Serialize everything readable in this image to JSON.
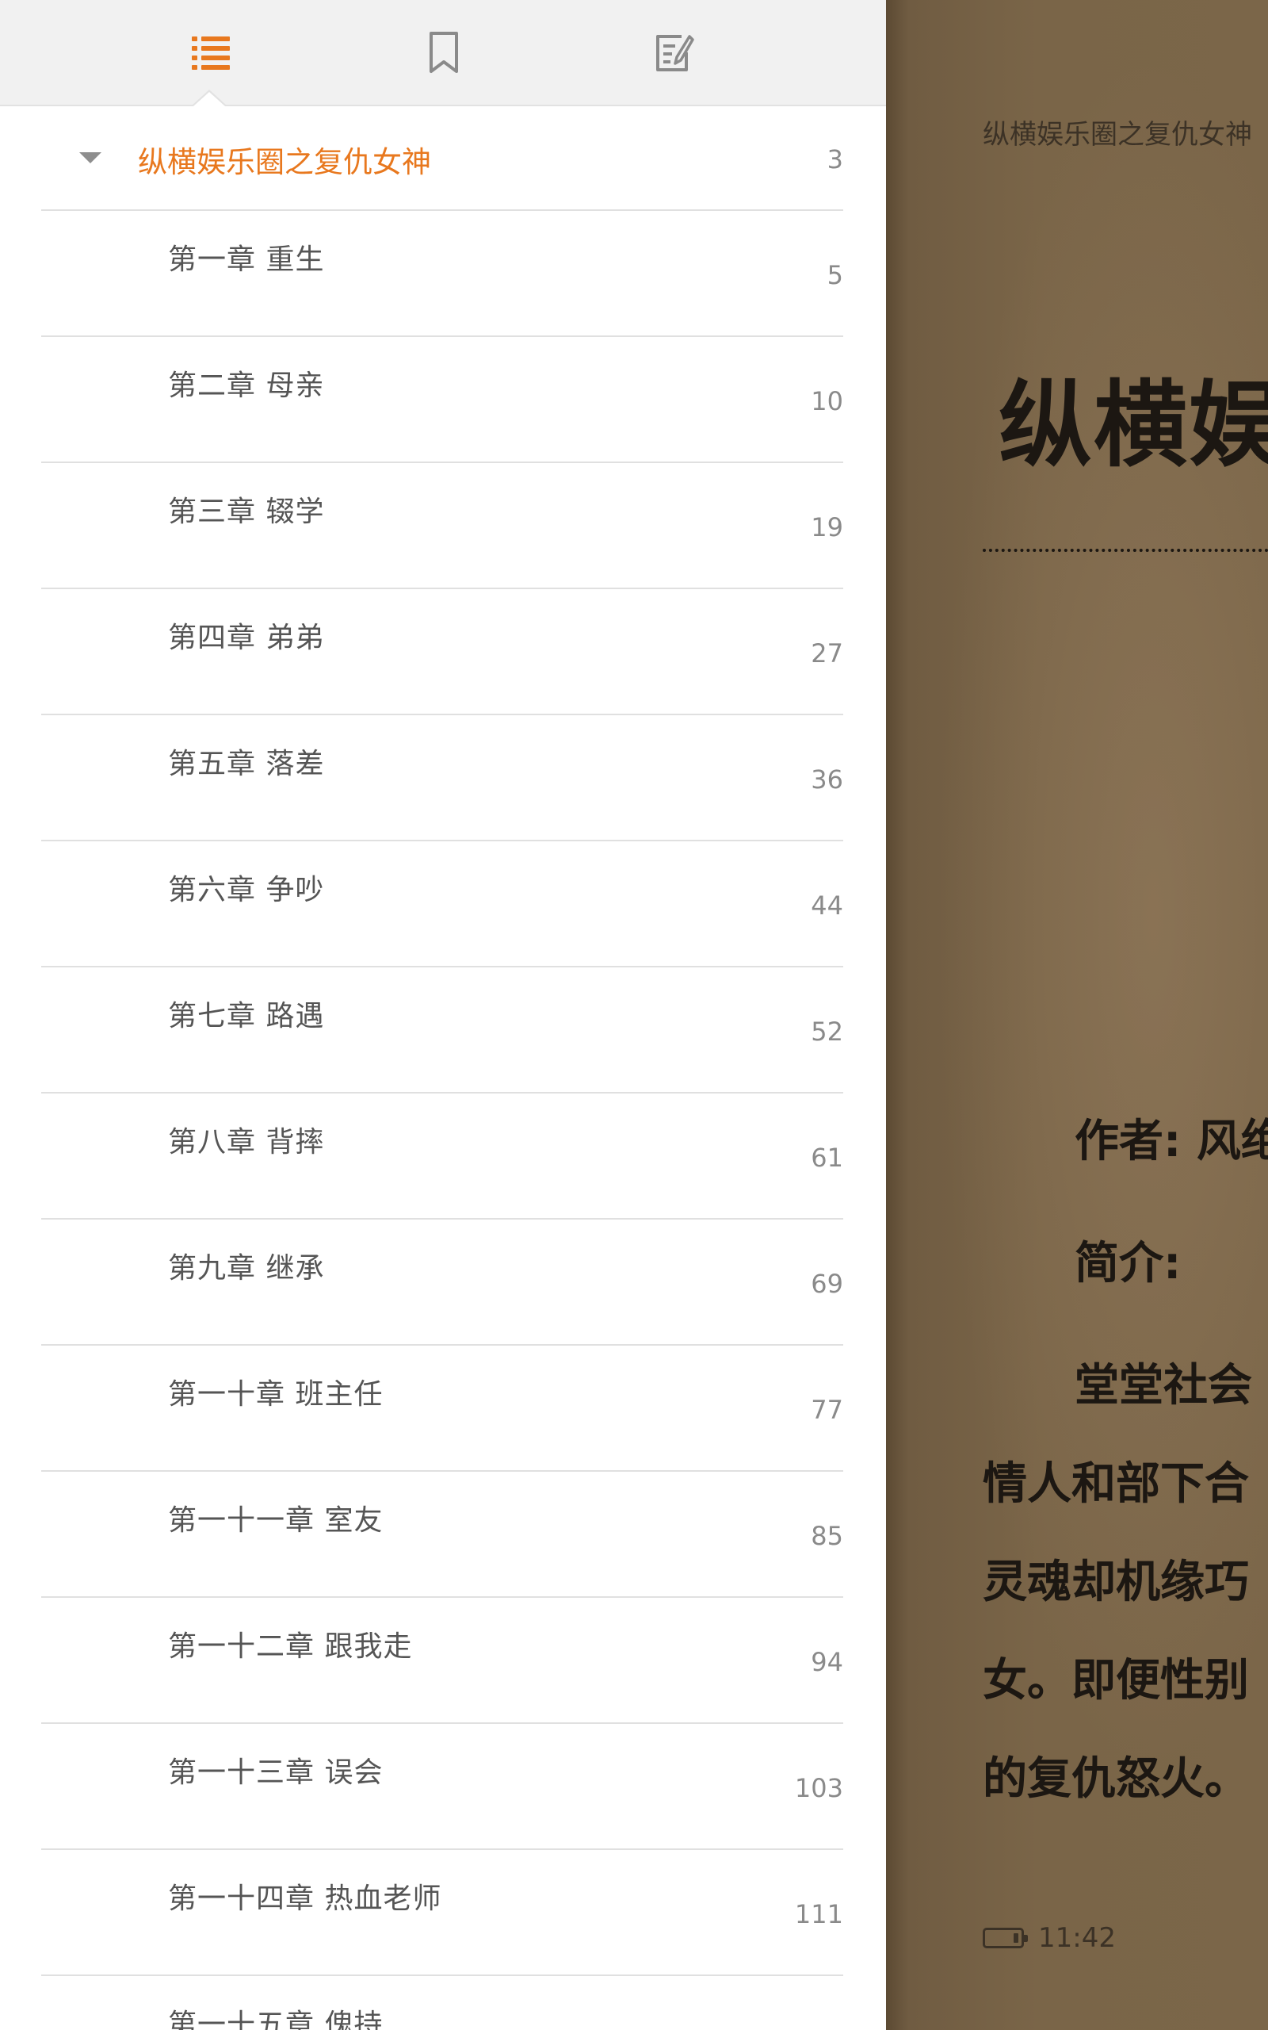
{
  "toc": {
    "tabs": [
      {
        "name": "contents",
        "icon": "list-icon",
        "active": true
      },
      {
        "name": "bookmarks",
        "icon": "bookmark-icon",
        "active": false
      },
      {
        "name": "notes",
        "icon": "note-edit-icon",
        "active": false
      }
    ],
    "accent_color": "#e8781e",
    "book": {
      "title": "纵横娱乐圈之复仇女神",
      "page": "3"
    },
    "chapters": [
      {
        "title": "第一章 重生",
        "page": "5"
      },
      {
        "title": "第二章 母亲",
        "page": "10"
      },
      {
        "title": "第三章 辍学",
        "page": "19"
      },
      {
        "title": "第四章 弟弟",
        "page": "27"
      },
      {
        "title": "第五章 落差",
        "page": "36"
      },
      {
        "title": "第六章 争吵",
        "page": "44"
      },
      {
        "title": "第七章 路遇",
        "page": "52"
      },
      {
        "title": "第八章 背摔",
        "page": "61"
      },
      {
        "title": "第九章 继承",
        "page": "69"
      },
      {
        "title": "第一十章 班主任",
        "page": "77"
      },
      {
        "title": "第一十一章 室友",
        "page": "85"
      },
      {
        "title": "第一十二章 跟我走",
        "page": "94"
      },
      {
        "title": "第一十三章 误会",
        "page": "103"
      },
      {
        "title": "第一十四章 热血老师",
        "page": "111"
      },
      {
        "title": "第一十五章 傀持",
        "page": ""
      }
    ]
  },
  "reader": {
    "header": "纵横娱乐圈之复仇女神",
    "title": "纵横娱",
    "author_line": "作者: 风绝",
    "intro_label": "简介:",
    "body_lines": [
      "堂堂社会",
      "情人和部下合",
      "灵魂却机缘巧",
      "女。即便性别",
      "的复仇怒火。"
    ],
    "time": "11:42"
  }
}
